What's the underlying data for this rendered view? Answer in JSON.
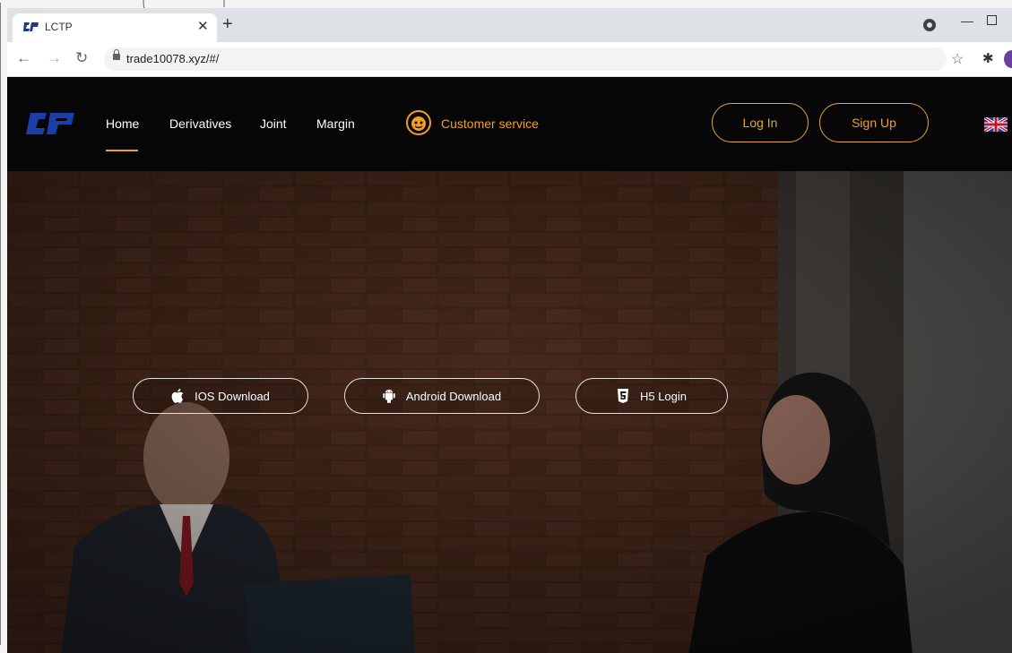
{
  "browser": {
    "tab_title": "LCTP",
    "url": "trade10078.xyz/#/"
  },
  "site": {
    "nav": [
      "Home",
      "Derivatives",
      "Joint",
      "Margin"
    ],
    "active_nav": "Home",
    "customer_service": "Customer service",
    "login": "Log In",
    "signup": "Sign Up",
    "language_flag": "uk-flag-icon"
  },
  "hero": {
    "buttons": [
      {
        "label": "IOS Download",
        "icon": "apple-icon"
      },
      {
        "label": "Android Download",
        "icon": "android-icon"
      },
      {
        "label": "H5 Login",
        "icon": "html5-icon"
      }
    ]
  },
  "colors": {
    "accent": "#f0a020",
    "header_bg": "#060606",
    "hero_bg": "#3a2218"
  }
}
